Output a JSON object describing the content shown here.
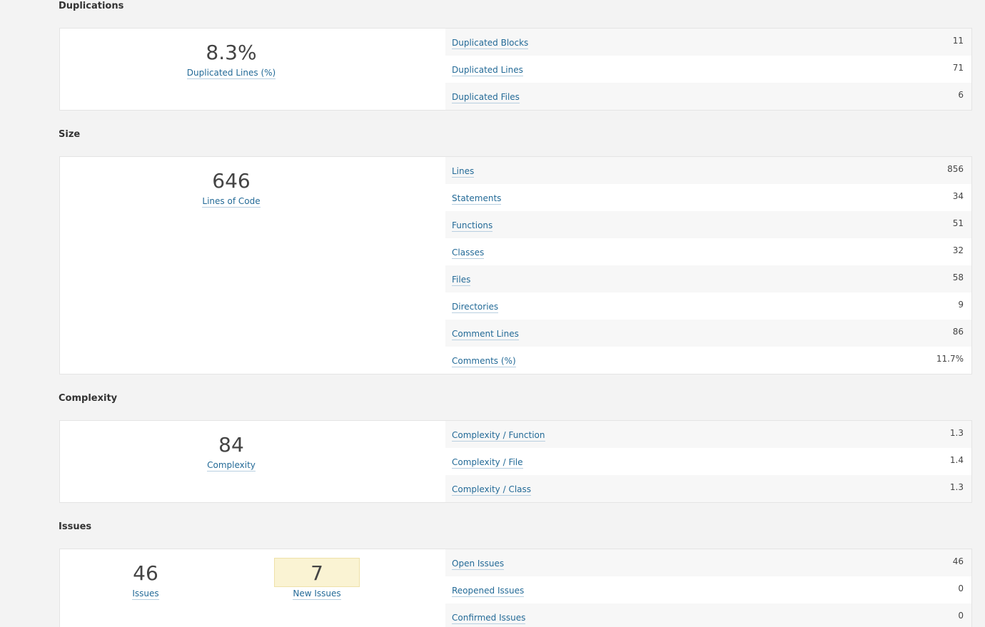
{
  "duplications": {
    "title": "Duplications",
    "main": {
      "value": "8.3%",
      "label": "Duplicated Lines (%)"
    },
    "rows": [
      {
        "label": "Duplicated Blocks",
        "value": "11"
      },
      {
        "label": "Duplicated Lines",
        "value": "71"
      },
      {
        "label": "Duplicated Files",
        "value": "6"
      }
    ]
  },
  "size": {
    "title": "Size",
    "main": {
      "value": "646",
      "label": "Lines of Code"
    },
    "rows": [
      {
        "label": "Lines",
        "value": "856"
      },
      {
        "label": "Statements",
        "value": "34"
      },
      {
        "label": "Functions",
        "value": "51"
      },
      {
        "label": "Classes",
        "value": "32"
      },
      {
        "label": "Files",
        "value": "58"
      },
      {
        "label": "Directories",
        "value": "9"
      },
      {
        "label": "Comment Lines",
        "value": "86"
      },
      {
        "label": "Comments (%)",
        "value": "11.7%"
      }
    ]
  },
  "complexity": {
    "title": "Complexity",
    "main": {
      "value": "84",
      "label": "Complexity"
    },
    "rows": [
      {
        "label": "Complexity / Function",
        "value": "1.3"
      },
      {
        "label": "Complexity / File",
        "value": "1.4"
      },
      {
        "label": "Complexity / Class",
        "value": "1.3"
      }
    ]
  },
  "issues": {
    "title": "Issues",
    "main": {
      "value": "46",
      "label": "Issues"
    },
    "new": {
      "value": "7",
      "label": "New Issues"
    },
    "rows": [
      {
        "label": "Open Issues",
        "value": "46"
      },
      {
        "label": "Reopened Issues",
        "value": "0"
      },
      {
        "label": "Confirmed Issues",
        "value": "0"
      }
    ]
  }
}
